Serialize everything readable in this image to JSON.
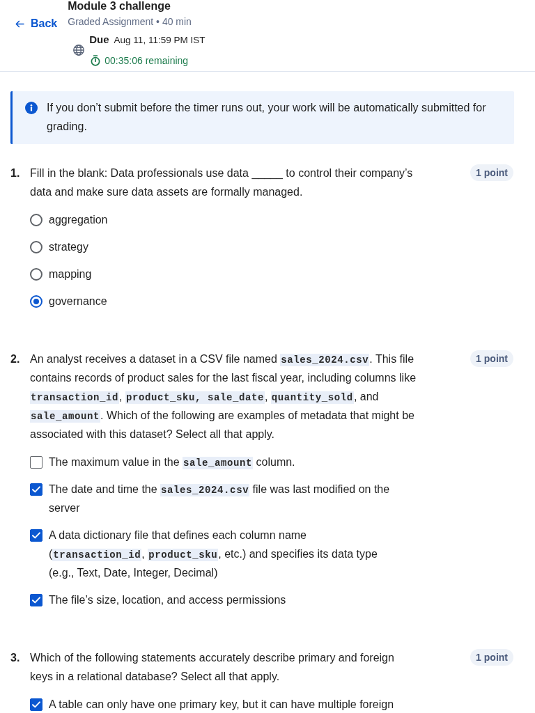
{
  "header": {
    "back_label": "Back",
    "title": "Module 3 challenge",
    "subtitle": "Graded Assignment • 40 min",
    "due_label": "Due",
    "due_date": "Aug 11, 11:59 PM IST",
    "timer": "00:35:06 remaining"
  },
  "notice": {
    "text": "If you don’t submit before the timer runs out, your work will be automatically submitted for grading."
  },
  "questions": [
    {
      "number": "1.",
      "kind": "single",
      "points": "1 point",
      "prompt": [
        {
          "kind": "text",
          "text": "Fill in the blank: Data professionals use data _____ to control their company’s data and make sure data assets are formally managed."
        }
      ],
      "options": [
        {
          "text": [
            {
              "kind": "text",
              "text": "aggregation"
            }
          ],
          "selected": false
        },
        {
          "text": [
            {
              "kind": "text",
              "text": "strategy"
            }
          ],
          "selected": false
        },
        {
          "text": [
            {
              "kind": "text",
              "text": "mapping"
            }
          ],
          "selected": false
        },
        {
          "text": [
            {
              "kind": "text",
              "text": "governance"
            }
          ],
          "selected": true
        }
      ]
    },
    {
      "number": "2.",
      "kind": "multiple",
      "points": "1 point",
      "prompt": [
        {
          "kind": "text",
          "text": "An analyst receives a dataset in a CSV file named "
        },
        {
          "kind": "code",
          "text": "sales_2024.csv"
        },
        {
          "kind": "text",
          "text": ". This file contains records of product sales for the last fiscal year, including columns like "
        },
        {
          "kind": "code",
          "text": "transaction_id"
        },
        {
          "kind": "text",
          "text": ", "
        },
        {
          "kind": "code",
          "text": "product_sku, sale_date"
        },
        {
          "kind": "text",
          "text": ", "
        },
        {
          "kind": "code",
          "text": "quantity_sold"
        },
        {
          "kind": "text",
          "text": ", and "
        },
        {
          "kind": "code",
          "text": "sale_amount"
        },
        {
          "kind": "text",
          "text": ". Which of the following are examples of metadata that might be associated with this dataset? Select all that apply."
        }
      ],
      "options": [
        {
          "text": [
            {
              "kind": "text",
              "text": "The maximum value in the "
            },
            {
              "kind": "code",
              "text": "sale_amount"
            },
            {
              "kind": "text",
              "text": " column."
            }
          ],
          "checked": false
        },
        {
          "text": [
            {
              "kind": "text",
              "text": "The date and time the "
            },
            {
              "kind": "code",
              "text": "sales_2024.csv"
            },
            {
              "kind": "text",
              "text": " file was last modified on the server"
            }
          ],
          "checked": true
        },
        {
          "text": [
            {
              "kind": "text",
              "text": "A data dictionary file that defines each column name ("
            },
            {
              "kind": "code",
              "text": "transaction_id"
            },
            {
              "kind": "text",
              "text": ", "
            },
            {
              "kind": "code",
              "text": "product_sku"
            },
            {
              "kind": "text",
              "text": ", etc.) and specifies its data type (e.g., Text, Date, Integer, Decimal)"
            }
          ],
          "checked": true
        },
        {
          "text": [
            {
              "kind": "text",
              "text": "The file’s size, location, and access permissions"
            }
          ],
          "checked": true
        }
      ]
    },
    {
      "number": "3.",
      "kind": "multiple",
      "points": "1 point",
      "prompt": [
        {
          "kind": "text",
          "text": "Which of the following statements accurately describe primary and foreign keys in a relational database? Select all that apply."
        }
      ],
      "options": [
        {
          "text": [
            {
              "kind": "text",
              "text": "A table can only have one primary key, but it can have multiple foreign"
            }
          ],
          "checked": true
        }
      ]
    }
  ]
}
